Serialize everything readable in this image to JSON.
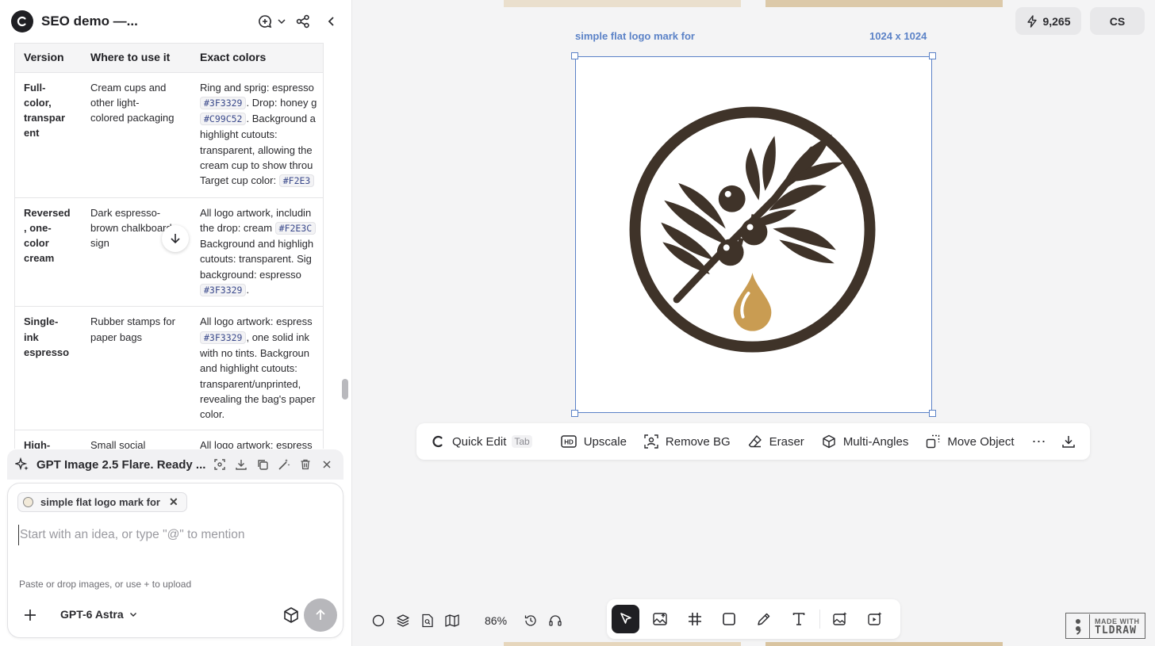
{
  "header": {
    "title": "SEO demo —..."
  },
  "table": {
    "headers": [
      "Version",
      "Where to use it",
      "Exact colors"
    ],
    "rows": [
      {
        "version": [
          "Full-",
          "color,",
          "transpar",
          "ent"
        ],
        "where": [
          "Cream cups and",
          "other light-",
          "colored packaging"
        ],
        "colors": [
          [
            "Ring and sprig: espresso"
          ],
          [
            "#3F3329",
            ". Drop: honey g"
          ],
          [
            "#C99C52",
            ". Background a"
          ],
          [
            "highlight cutouts:"
          ],
          [
            "transparent, allowing the"
          ],
          [
            "cream cup to show throu"
          ],
          [
            "Target cup color: ",
            "#F2E3"
          ]
        ]
      },
      {
        "version": [
          "Reversed",
          ", one-",
          "color",
          "cream"
        ],
        "where": [
          "Dark espresso-",
          "brown chalkboard",
          "sign"
        ],
        "colors": [
          [
            "All logo artwork, includin"
          ],
          [
            "the drop: cream ",
            "#F2E3C"
          ],
          [
            "Background and highligh"
          ],
          [
            "cutouts: transparent. Sig"
          ],
          [
            "background: espresso"
          ],
          [
            "#3F3329",
            "."
          ]
        ]
      },
      {
        "version": [
          "Single-",
          "ink",
          "espresso"
        ],
        "where": [
          "Rubber stamps for",
          "paper bags"
        ],
        "colors": [
          [
            "All logo artwork: espress"
          ],
          [
            "#3F3329",
            ", one solid ink"
          ],
          [
            "with no tints. Backgroun"
          ],
          [
            "and highlight cutouts:"
          ],
          [
            "transparent/unprinted,"
          ],
          [
            "revealing the bag's paper"
          ],
          [
            "color."
          ]
        ]
      },
      {
        "version": [
          "High-"
        ],
        "where": [
          "Small social"
        ],
        "colors": [
          [
            "All logo artwork: espress"
          ]
        ]
      }
    ]
  },
  "generation": {
    "label": "GPT Image 2.5 Flare. Ready ..."
  },
  "composer": {
    "chip_label": "simple flat logo mark for",
    "placeholder": "Start with an idea, or type \"@\" to mention",
    "upload_hint": "Paste or drop images, or use + to upload",
    "model": "GPT-6 Astra"
  },
  "canvas": {
    "credits": "9,265",
    "user_initials": "CS",
    "image_name": "simple flat logo mark for",
    "image_size": "1024 x 1024",
    "zoom": "86%",
    "logo_colors": {
      "espresso": "#3F3329",
      "honey": "#C99C52"
    }
  },
  "image_toolbar": {
    "quick_edit": "Quick Edit",
    "quick_edit_key": "Tab",
    "upscale": "Upscale",
    "remove_bg": "Remove BG",
    "eraser": "Eraser",
    "multi_angles": "Multi-Angles",
    "move_object": "Move Object"
  },
  "badge": {
    "line1": "MADE WITH",
    "line2": "TLDRAW"
  },
  "icons": [
    "chat-plus-icon",
    "share-icon",
    "collapse-icon",
    "sparkle-icon",
    "crop-icon",
    "download-icon",
    "copy-icon",
    "magic-wand-icon",
    "trash-icon",
    "close-icon",
    "plus-icon",
    "cube-icon",
    "send-arrow-icon",
    "lightning-icon",
    "select-tool-icon",
    "image-upload-icon",
    "frame-icon",
    "rectangle-icon",
    "pencil-icon",
    "text-icon"
  ]
}
